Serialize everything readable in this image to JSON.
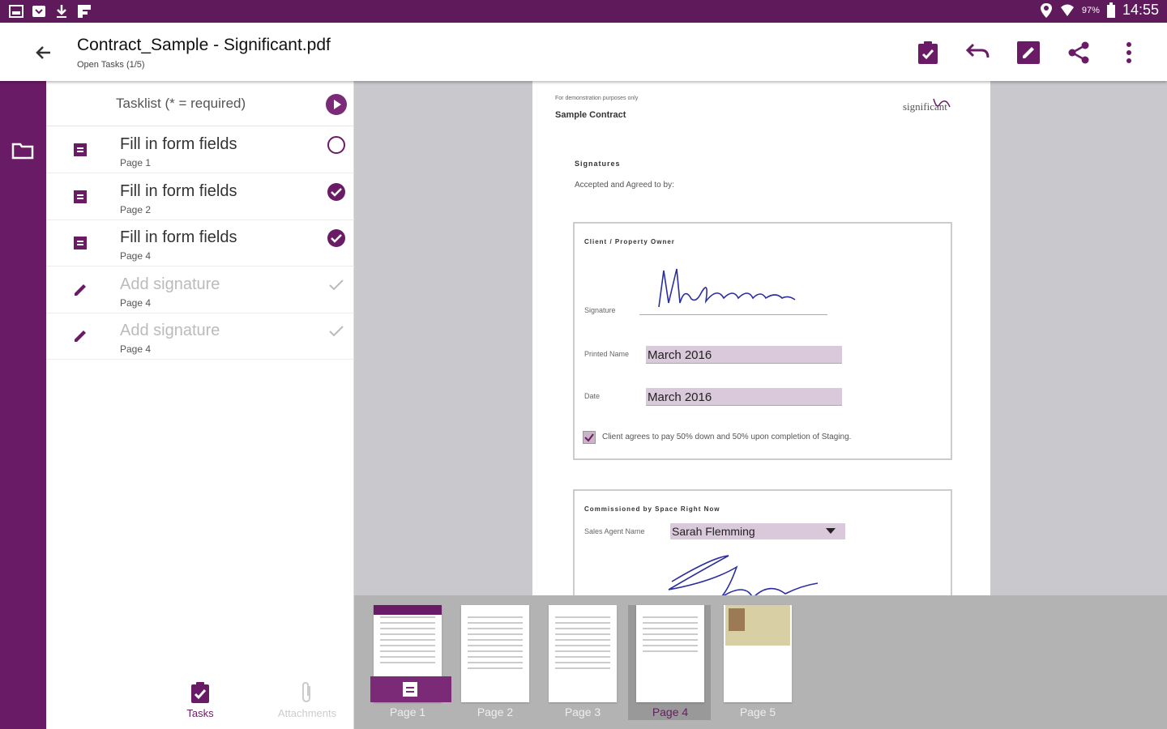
{
  "status_bar": {
    "battery": "97%",
    "time": "14:55"
  },
  "app_bar": {
    "title": "Contract_Sample - Significant.pdf",
    "subtitle": "Open Tasks (1/5)"
  },
  "tasklist": {
    "header": "Tasklist (* = required)",
    "tasks": [
      {
        "name": "Fill in form fields",
        "page": "Page 1",
        "state": "open",
        "icon": "form-icon"
      },
      {
        "name": "Fill in form fields",
        "page": "Page 2",
        "state": "done",
        "icon": "form-icon"
      },
      {
        "name": "Fill in form fields",
        "page": "Page 4",
        "state": "done",
        "icon": "form-icon"
      },
      {
        "name": "Add signature",
        "page": "Page 4",
        "state": "disabled",
        "icon": "pen-icon"
      },
      {
        "name": "Add signature",
        "page": "Page 4",
        "state": "disabled",
        "icon": "pen-icon"
      }
    ],
    "tabs": {
      "tasks": "Tasks",
      "attachments": "Attachments"
    }
  },
  "document": {
    "demo_note": "For demonstration purposes only",
    "title": "Sample Contract",
    "section": "Signatures",
    "accepted": "Accepted and Agreed to by:",
    "client_box": {
      "title": "Client / Property Owner",
      "signature_label": "Signature",
      "printed_name_label": "Printed Name",
      "printed_name_value": "March 2016",
      "date_label": "Date",
      "date_value": "March 2016",
      "checkbox_text": "Client agrees to pay 50% down and 50% upon completion of Staging."
    },
    "commission_box": {
      "title": "Commissioned by Space Right Now",
      "agent_label": "Sales Agent Name",
      "agent_value": "Sarah Flemming"
    }
  },
  "thumbnails": [
    {
      "label": "Page 1"
    },
    {
      "label": "Page 2"
    },
    {
      "label": "Page 3"
    },
    {
      "label": "Page 4"
    },
    {
      "label": "Page 5"
    }
  ],
  "colors": {
    "brand": "#6a1b66",
    "accent": "#7a2a76",
    "field": "#dac9da"
  }
}
